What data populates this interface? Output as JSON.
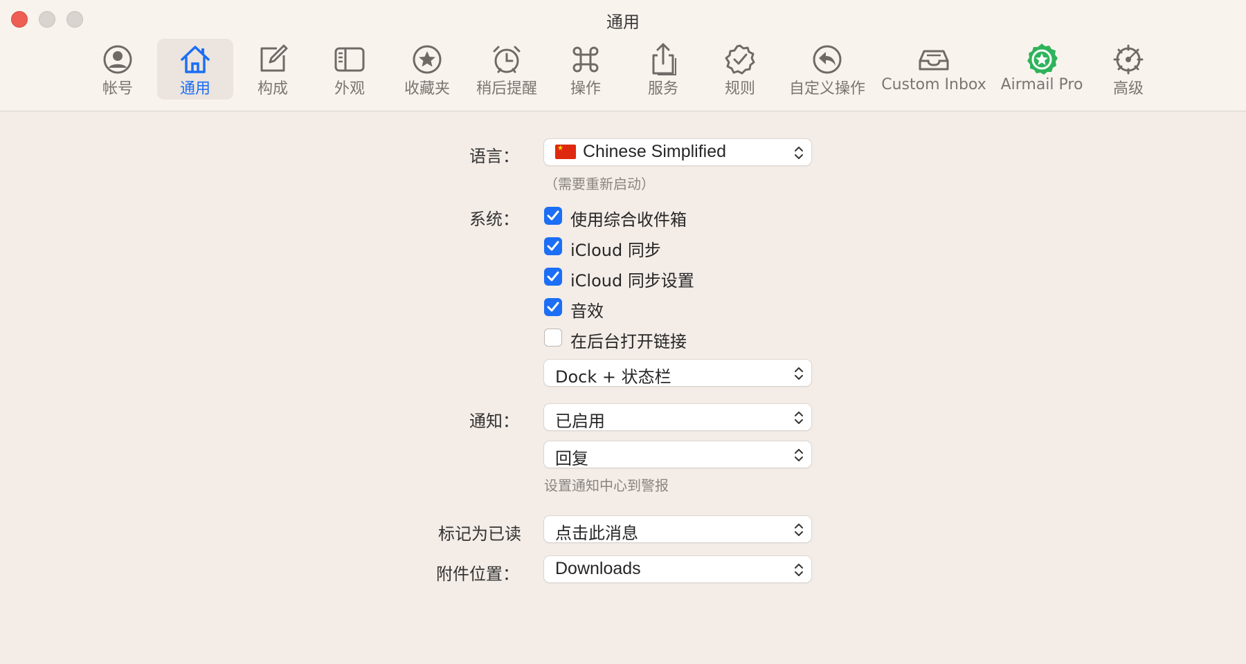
{
  "window": {
    "title": "通用"
  },
  "toolbar": {
    "items": [
      {
        "label": "帐号",
        "icon": "person-circle-icon"
      },
      {
        "label": "通用",
        "icon": "house-icon",
        "selected": true
      },
      {
        "label": "构成",
        "icon": "compose-icon"
      },
      {
        "label": "外观",
        "icon": "sidebar-layout-icon"
      },
      {
        "label": "收藏夹",
        "icon": "star-circle-icon"
      },
      {
        "label": "稍后提醒",
        "icon": "alarm-clock-icon"
      },
      {
        "label": "操作",
        "icon": "command-icon"
      },
      {
        "label": "服务",
        "icon": "share-icon"
      },
      {
        "label": "规则",
        "icon": "checkmark-seal-icon"
      },
      {
        "label": "自定义操作",
        "icon": "reply-circle-icon"
      },
      {
        "label": "Custom Inbox",
        "icon": "tray-icon"
      },
      {
        "label": "Airmail Pro",
        "icon": "airmail-pro-badge-icon"
      },
      {
        "label": "高级",
        "icon": "gear-icon"
      }
    ]
  },
  "language": {
    "label": "语言：",
    "value": "Chinese Simplified",
    "note": "（需要重新启动）",
    "flag_icon": "china-flag-icon"
  },
  "system": {
    "label": "系统：",
    "options": [
      {
        "label": "使用综合收件箱",
        "checked": true
      },
      {
        "label": "iCloud 同步",
        "checked": true
      },
      {
        "label": "iCloud 同步设置",
        "checked": true
      },
      {
        "label": "音效",
        "checked": true
      },
      {
        "label": "在后台打开链接",
        "checked": false
      }
    ],
    "dock_mode": "Dock + 状态栏"
  },
  "notifications": {
    "label": "通知：",
    "state": "已启用",
    "scope": "回复",
    "note": "设置通知中心到警报"
  },
  "mark_read": {
    "label": "标记为已读",
    "value": "点击此消息"
  },
  "attachments": {
    "label": "附件位置：",
    "value": "Downloads"
  },
  "colors": {
    "accent": "#1b6ef5",
    "airmail_pro_green": "#2fb35a"
  }
}
